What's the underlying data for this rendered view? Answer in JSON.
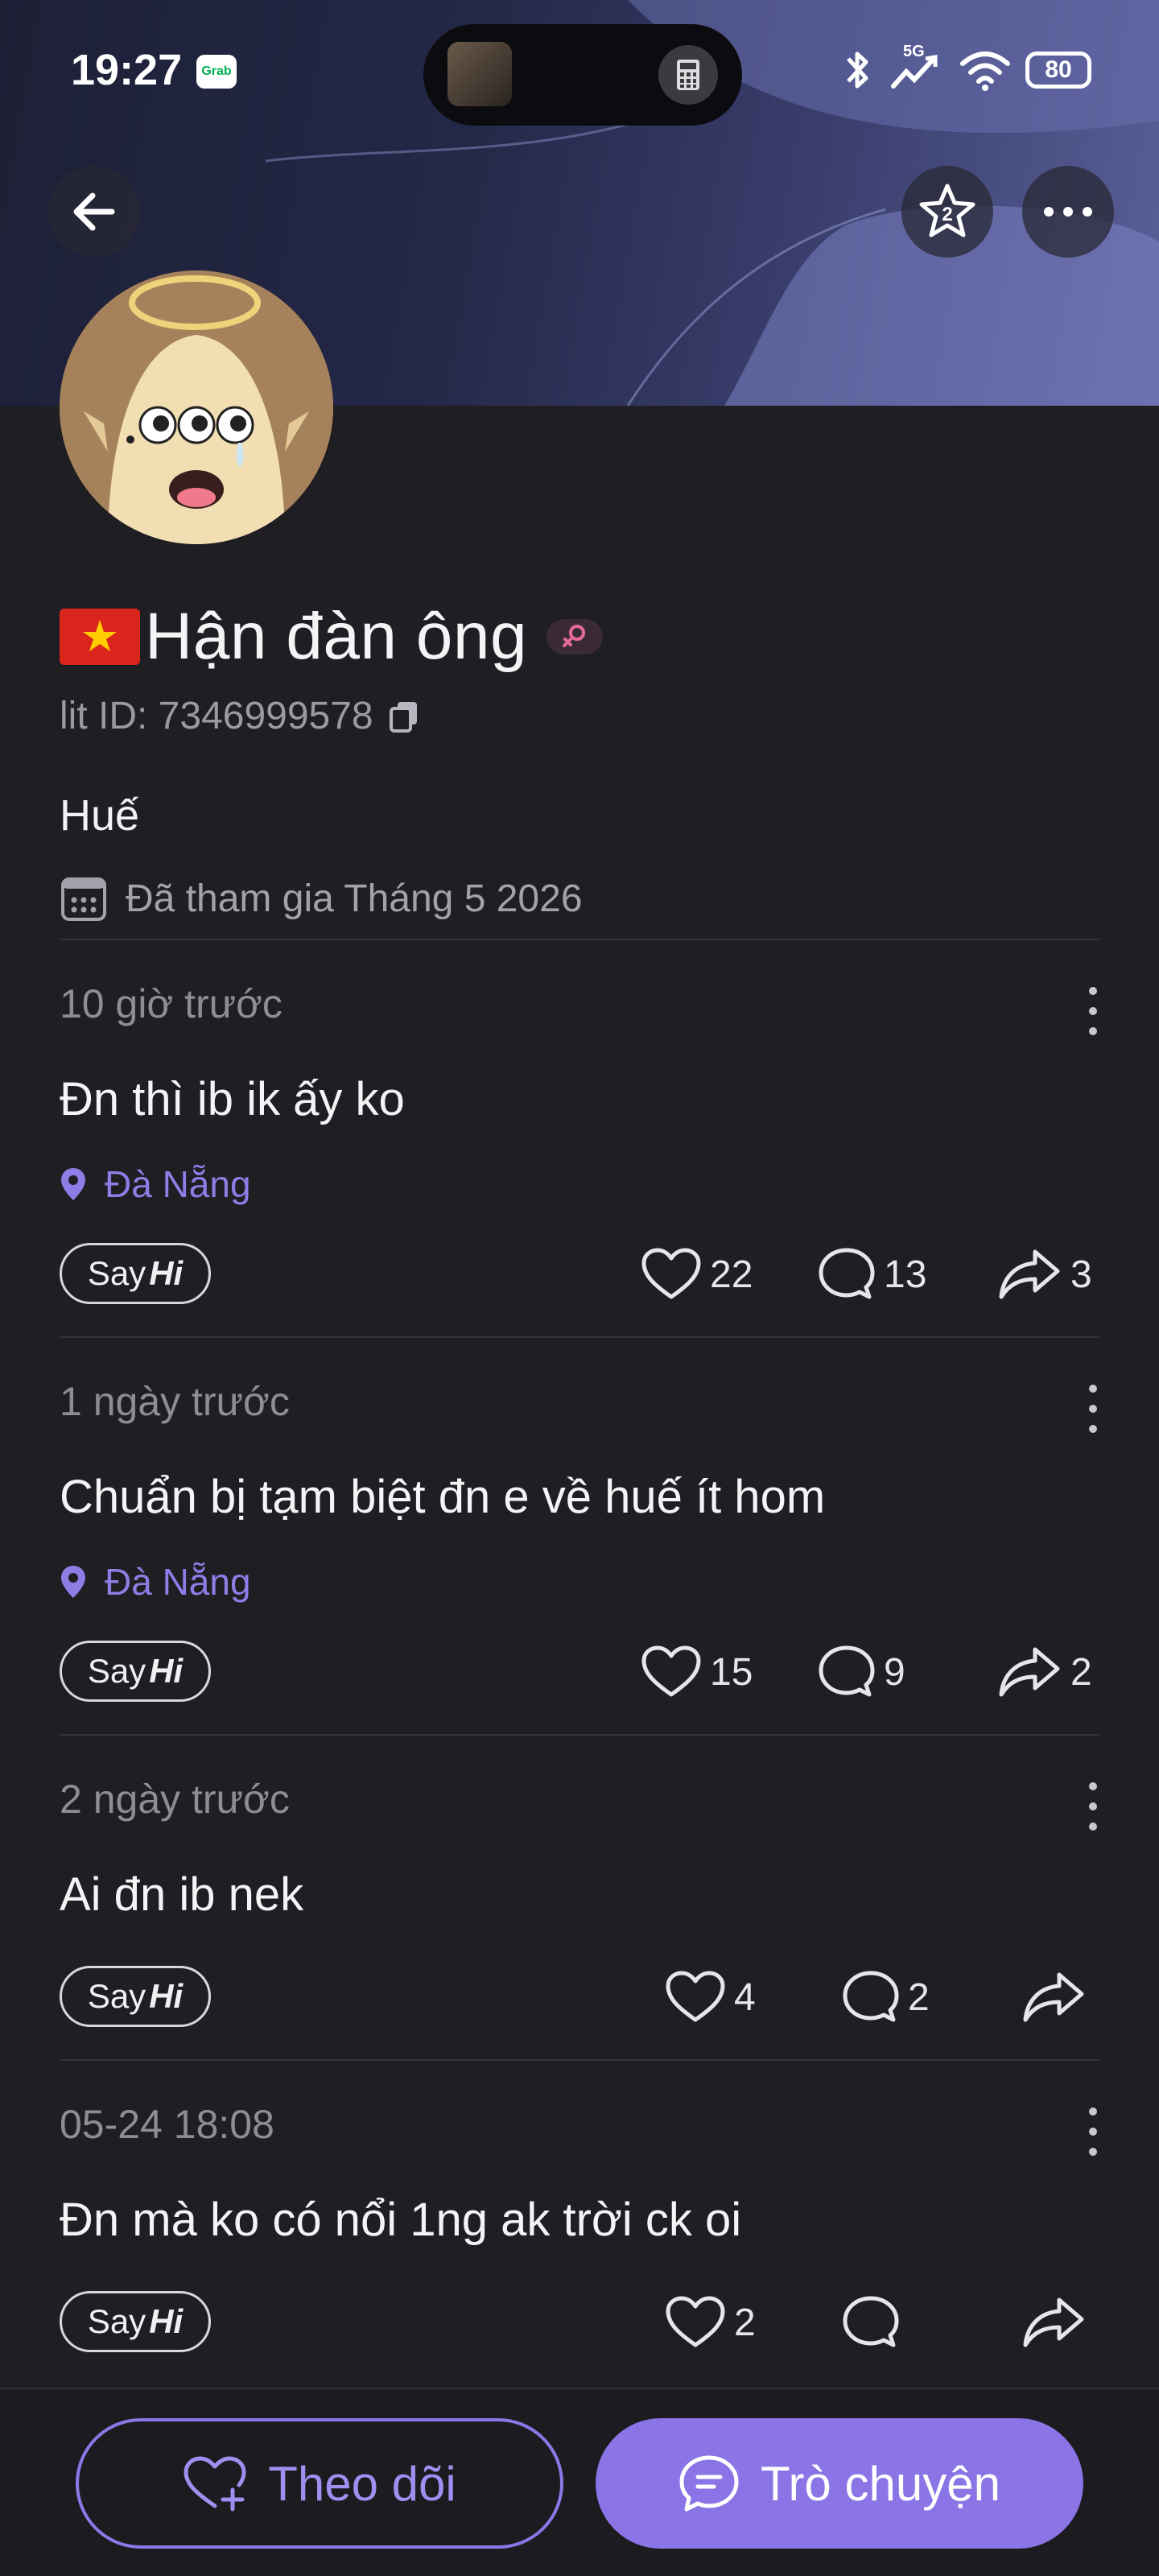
{
  "status_bar": {
    "time": "19:27",
    "grab_label": "Grab",
    "network": "5G",
    "battery": "80"
  },
  "header": {
    "back_icon": "arrow-left-icon",
    "favorite_badge": "2",
    "more_icon": "more-horizontal-icon"
  },
  "profile": {
    "name": "Hận đàn ông",
    "flag": "vietnam-flag-icon",
    "gender_icon": "female-symbol-icon",
    "id_label": "lit ID: 7346999578",
    "city": "Huế",
    "joined": "Đã tham gia Tháng 5 2026"
  },
  "posts": [
    {
      "time": "10 giờ trước",
      "text": "Đn thì ib ik ấy ko",
      "location": "Đà Nẵng",
      "likes": "22",
      "comments": "13",
      "shares": "3"
    },
    {
      "time": "1 ngày trước",
      "text": "Chuẩn bị tạm biệt đn e về huế ít hom",
      "location": "Đà Nẵng",
      "likes": "15",
      "comments": "9",
      "shares": "2"
    },
    {
      "time": "2 ngày trước",
      "text": "Ai đn ib nek",
      "location": "",
      "likes": "4",
      "comments": "2",
      "shares": ""
    },
    {
      "time": "05-24 18:08",
      "text": "Đn mà ko có nổi 1ng ak trời ck oi",
      "location": "",
      "likes": "2",
      "comments": "",
      "shares": ""
    }
  ],
  "sayhi": {
    "say": "Say",
    "hi": "Hi"
  },
  "bottom": {
    "follow_label": "Theo dõi",
    "chat_label": "Trò chuyện"
  },
  "colors": {
    "accent": "#8a74e6",
    "background": "#1f1e23",
    "location": "#8f7de6"
  }
}
